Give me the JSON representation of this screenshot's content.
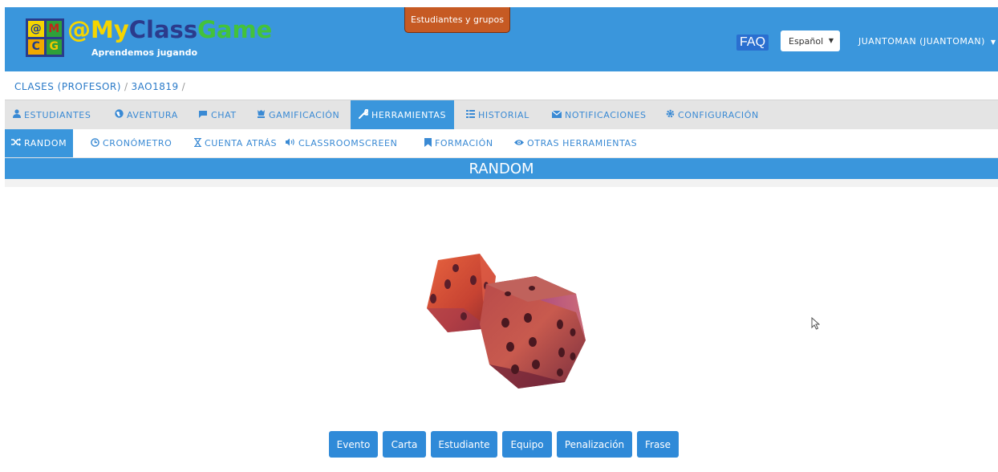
{
  "header": {
    "logo_cells": [
      "@",
      "M",
      "C",
      "G"
    ],
    "brand_at": "@",
    "brand_my": "My",
    "brand_class": "Class",
    "brand_game": "Game",
    "tagline": "Aprendemos jugando",
    "top_tab": "Estudiantes y grupos",
    "faq": "FAQ",
    "language": "Español",
    "user": "JUANTOMAN (JUANTOMAN)"
  },
  "breadcrumb": {
    "root": "CLASES (PROFESOR)",
    "class": "3AO1819",
    "sep": "/"
  },
  "main_nav": [
    {
      "label": "ESTUDIANTES",
      "icon": "user-icon"
    },
    {
      "label": "AVENTURA",
      "icon": "globe-icon"
    },
    {
      "label": "CHAT",
      "icon": "comment-icon"
    },
    {
      "label": "GAMIFICACIÓN",
      "icon": "chess-icon"
    },
    {
      "label": "HERRAMIENTAS",
      "icon": "wrench-icon",
      "active": true
    },
    {
      "label": "HISTORIAL",
      "icon": "list-icon"
    },
    {
      "label": "NOTIFICACIONES",
      "icon": "envelope-icon"
    },
    {
      "label": "CONFIGURACIÓN",
      "icon": "cog-icon"
    }
  ],
  "sub_nav": [
    {
      "label": "RANDOM",
      "icon": "shuffle-icon",
      "active": true
    },
    {
      "label": "CRONÓMETRO",
      "icon": "clock-icon"
    },
    {
      "label": "CUENTA ATRÁS",
      "icon": "hourglass-icon"
    },
    {
      "label": "CLASSROOMSCREEN",
      "icon": "volume-icon"
    },
    {
      "label": "FORMACIÓN",
      "icon": "bookmark-icon"
    },
    {
      "label": "OTRAS HERRAMIENTAS",
      "icon": "eye-icon"
    }
  ],
  "section_title": "RANDOM",
  "actions": [
    "Evento",
    "Carta",
    "Estudiante",
    "Equipo",
    "Penalización",
    "Frase"
  ],
  "colors": {
    "primary": "#3a96dc",
    "button": "#2f8ad8",
    "top_tab": "#c65a23",
    "dice": "#c8483a"
  }
}
